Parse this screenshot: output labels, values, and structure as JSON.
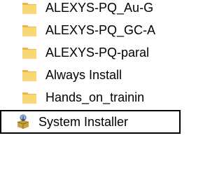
{
  "tree": {
    "items": [
      {
        "label": "ALEXYS-PQ_Au-G",
        "icon": "folder-icon"
      },
      {
        "label": "ALEXYS-PQ_GC-A",
        "icon": "folder-icon"
      },
      {
        "label": "ALEXYS-PQ-paral",
        "icon": "folder-icon"
      },
      {
        "label": "Always Install",
        "icon": "folder-icon"
      },
      {
        "label": "Hands_on_trainin",
        "icon": "folder-icon"
      },
      {
        "label": "System Installer",
        "icon": "installer-icon",
        "selected": true
      }
    ]
  },
  "colors": {
    "folder": "#F8D775",
    "folder_dark": "#E8B84A",
    "selection_border": "#000000"
  }
}
